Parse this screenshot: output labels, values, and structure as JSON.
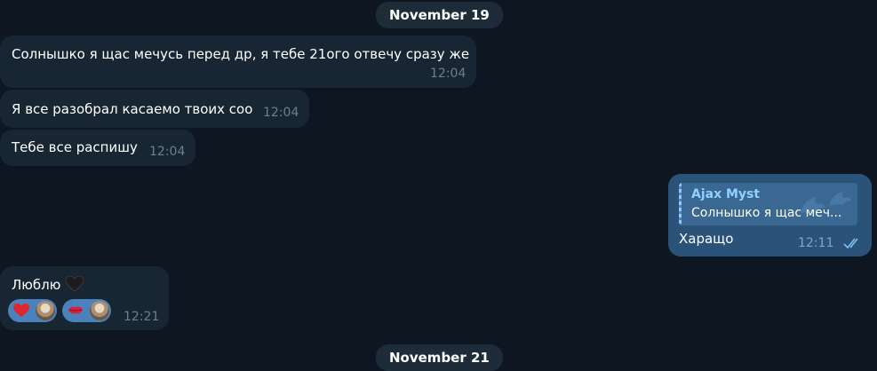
{
  "dates": {
    "nov19": "November 19",
    "nov21": "November 21"
  },
  "messages": [
    {
      "text": "Солнышко я щас мечусь перед др, я тебе 21ого отвечу сразу же",
      "time": "12:04"
    },
    {
      "text": "Я все разобрал касаемо твоих соо",
      "time": "12:04"
    },
    {
      "text": "Тебе все распишу",
      "time": "12:04"
    },
    {
      "reply_author": "Ajax Myst",
      "reply_text": "Солнышко я щас меч...",
      "text": "Харащо",
      "time": "12:11",
      "status_icon": "double-check-icon"
    },
    {
      "text": "Люблю",
      "emoji_icon": "black-heart-icon",
      "time": "12:21",
      "reactions": [
        {
          "emoji_icon": "red-heart-icon"
        },
        {
          "emoji_icon": "kiss-mark-icon"
        }
      ]
    }
  ],
  "colors": {
    "background": "#0e1621",
    "incoming_bubble": "#182533",
    "outgoing_bubble": "#2b5278",
    "reply_author": "#8fd1ff",
    "reaction_bg": "#4a82bb",
    "time_text": "#6d7f8f"
  }
}
